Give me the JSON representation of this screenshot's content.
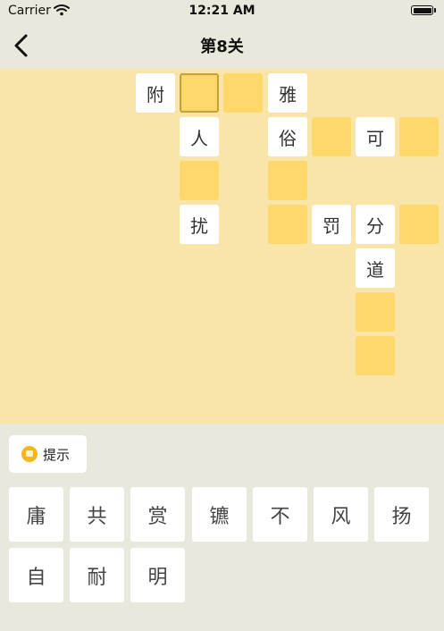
{
  "status_bar": {
    "carrier": "Carrier",
    "time": "12:21 AM"
  },
  "nav": {
    "title": "第8关",
    "back_icon": "chevron-left-icon"
  },
  "board": {
    "letters": {
      "c0": "附",
      "c3": "雅",
      "c4": "人",
      "c5": "俗",
      "c7": "可",
      "c10": "扰",
      "c12": "罚",
      "c13": "分",
      "c15": "道"
    }
  },
  "hint": {
    "label": "提示",
    "icon": "lightbulb-coin-icon"
  },
  "tiles": [
    "庸",
    "共",
    "赏",
    "镳",
    "不",
    "风",
    "扬",
    "自",
    "耐",
    "明"
  ],
  "colors": {
    "board": "#f9e5a9",
    "empty_cell": "#fed86b",
    "background": "#e9e8dc",
    "hint_icon": "#f5b618"
  }
}
